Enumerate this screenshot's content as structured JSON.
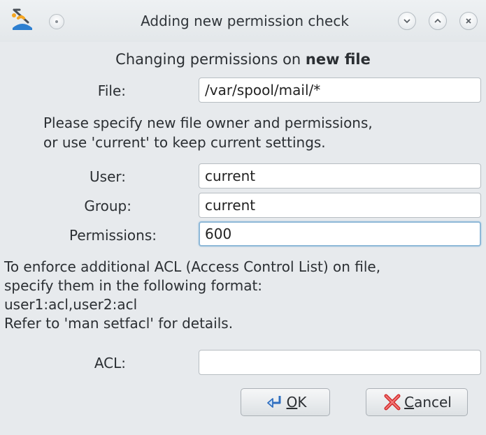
{
  "window": {
    "title": "Adding new permission check",
    "icons": {
      "app": "mageia-app-icon",
      "menu": "window-menu-icon",
      "minimize": "chevron-down-icon",
      "maximize": "chevron-up-icon",
      "close": "close-icon"
    }
  },
  "heading": {
    "prefix": "Changing permissions on ",
    "bold": "new file"
  },
  "file": {
    "label": "File:",
    "value": "/var/spool/mail/*"
  },
  "instructions": {
    "line1": "Please specify new file owner and permissions,",
    "line2": "or use 'current' to keep current settings."
  },
  "user": {
    "label": "User:",
    "value": "current"
  },
  "group": {
    "label": "Group:",
    "value": "current"
  },
  "permissions": {
    "label": "Permissions:",
    "value": "600"
  },
  "acl_help": {
    "line1": "To enforce additional ACL (Access Control List) on file,",
    "line2": "specify them in the following format:",
    "line3": "user1:acl,user2:acl",
    "line4": "Refer to 'man setfacl' for details."
  },
  "acl": {
    "label": "ACL:",
    "value": ""
  },
  "buttons": {
    "ok": {
      "mnemonic": "O",
      "rest": "K",
      "icon": "ok-arrow-icon"
    },
    "cancel": {
      "mnemonic": "C",
      "rest": "ancel",
      "icon": "cancel-x-icon"
    }
  }
}
